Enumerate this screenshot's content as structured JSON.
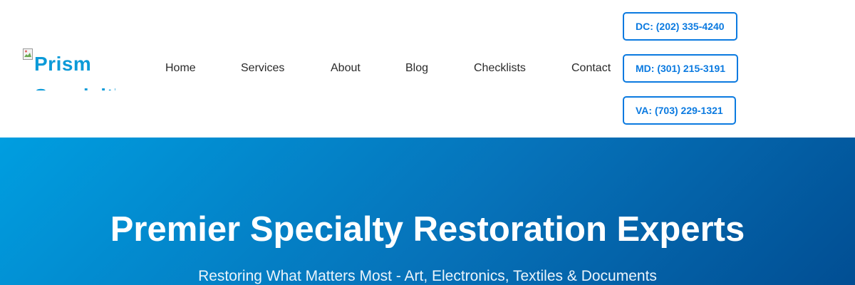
{
  "header": {
    "logo_alt": "Prism Specialties",
    "nav": {
      "home": "Home",
      "services": "Services",
      "about": "About",
      "blog": "Blog",
      "checklists": "Checklists",
      "contact": "Contact"
    },
    "phones": {
      "dc": "DC: (202) 335-4240",
      "md": "MD: (301) 215-3191",
      "va": "VA: (703) 229-1321"
    }
  },
  "hero": {
    "title": "Premier Specialty Restoration Experts",
    "subtitle": "Restoring What Matters Most - Art, Electronics, Textiles & Documents"
  },
  "colors": {
    "accent": "#0b7ae0",
    "logo": "#0b9ad8",
    "hero_start": "#009ee0",
    "hero_end": "#014e93"
  },
  "icons": {
    "logo": "broken-image-icon"
  }
}
